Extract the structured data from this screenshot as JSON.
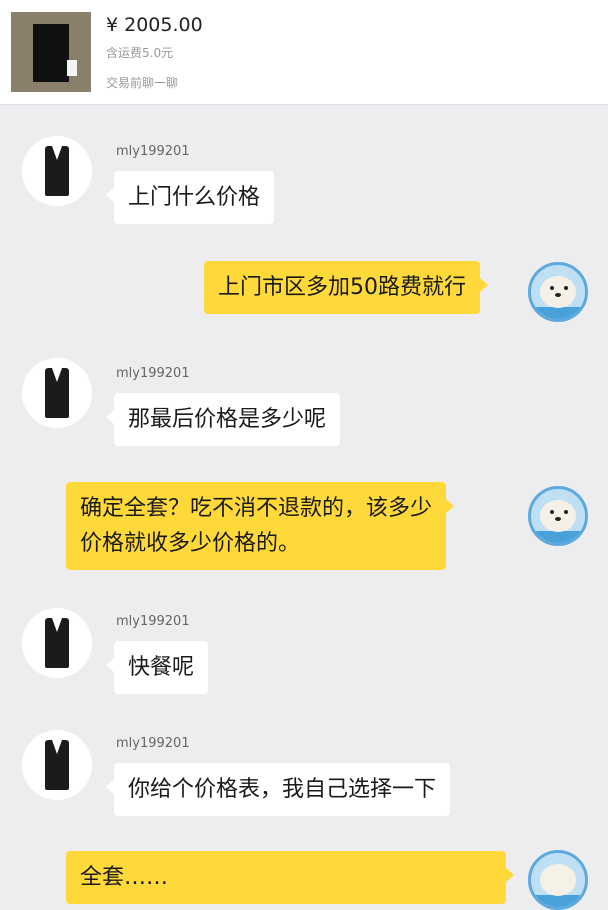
{
  "header": {
    "price": "¥ 2005.00",
    "shipping": "含运费5.0元",
    "trade_note": "交易前聊一聊"
  },
  "messages": [
    {
      "side": "left",
      "username": "mly199201",
      "text": "上门什么价格"
    },
    {
      "side": "right",
      "text": "上门市区多加50路费就行"
    },
    {
      "side": "left",
      "username": "mly199201",
      "text": "那最后价格是多少呢"
    },
    {
      "side": "right",
      "lines": [
        "确定全套？吃不消不退款的，该多少",
        "价格就收多少价格的。"
      ]
    },
    {
      "side": "left",
      "username": "mly199201",
      "text": "快餐呢"
    },
    {
      "side": "left",
      "username": "mly199201",
      "text": "你给个价格表，我自己选择一下"
    },
    {
      "side": "right",
      "text": "全套……"
    }
  ],
  "colors": {
    "background": "#ededf0",
    "own_bubble": "#ffd93a",
    "other_bubble": "#ffffff"
  },
  "icons": {
    "own_avatar": "seal-avatar-icon",
    "other_avatar": "vest-avatar-icon"
  }
}
